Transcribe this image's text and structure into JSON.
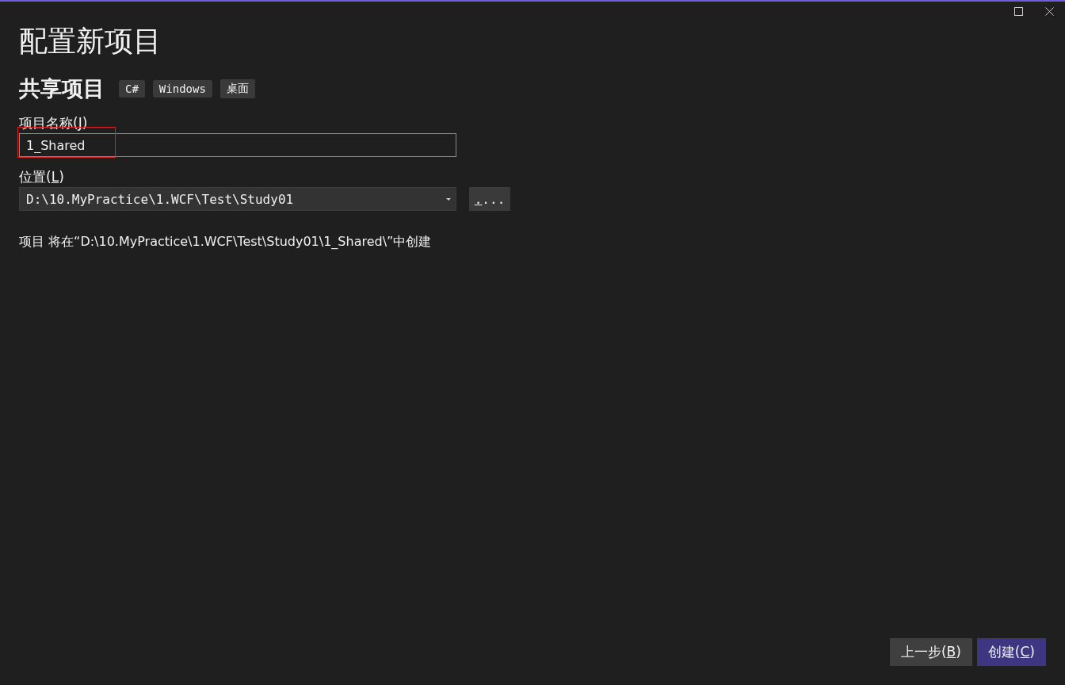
{
  "window": {
    "title": "配置新项目",
    "controls": [
      {
        "kind": "maximize"
      },
      {
        "kind": "close"
      }
    ]
  },
  "project": {
    "type_name": "共享项目",
    "tags": [
      "C#",
      "Windows",
      "桌面"
    ]
  },
  "name_field": {
    "label_before": "项目名称(",
    "access_key": "J",
    "label_after": ")",
    "value": "1_Shared",
    "highlighted": true
  },
  "location_field": {
    "label_before": "位置(",
    "access_key": "L",
    "label_after": ")",
    "value": "D:\\10.MyPractice\\1.WCF\\Test\\Study01",
    "browse_key": ".",
    "browse_rest": "..."
  },
  "summary": "项目 将在“D:\\10.MyPractice\\1.WCF\\Test\\Study01\\1_Shared\\”中创建",
  "buttons": [
    {
      "before": "上一步(",
      "key": "B",
      "after": ")",
      "kind": "secondary"
    },
    {
      "before": "创建(",
      "key": "C",
      "after": ")",
      "kind": "primary"
    }
  ]
}
